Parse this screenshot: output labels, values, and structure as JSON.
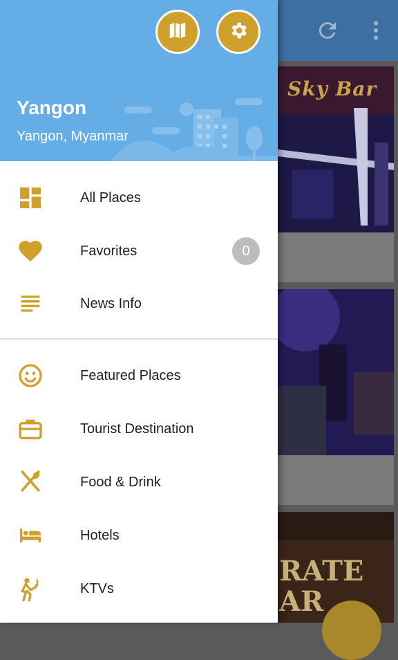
{
  "colors": {
    "accent": "#cfa12c",
    "header_bg": "#64ade6",
    "toolbar_bg": "#3d6fa3",
    "badge_bg": "#bdbdbd"
  },
  "header": {
    "city": "Yangon",
    "location": "Yangon, Myanmar",
    "map_button_icon": "map-icon",
    "settings_button_icon": "gear-icon"
  },
  "background": {
    "toolbar_icons": [
      "refresh-icon",
      "more-vert-icon"
    ],
    "cards": [
      {
        "sign_text": "Sky Bar"
      },
      {
        "sign_text": ""
      },
      {
        "sign_text": "RATE\nAR"
      }
    ]
  },
  "menu": {
    "primary": [
      {
        "label": "All Places",
        "icon": "dashboard-icon"
      },
      {
        "label": "Favorites",
        "icon": "heart-icon",
        "badge": "0"
      },
      {
        "label": "News Info",
        "icon": "news-icon"
      }
    ],
    "categories": [
      {
        "label": "Featured Places",
        "icon": "smiley-icon"
      },
      {
        "label": "Tourist Destination",
        "icon": "suitcase-icon"
      },
      {
        "label": "Food & Drink",
        "icon": "utensils-icon"
      },
      {
        "label": "Hotels",
        "icon": "bed-icon"
      },
      {
        "label": "KTVs",
        "icon": "karaoke-icon"
      }
    ]
  }
}
